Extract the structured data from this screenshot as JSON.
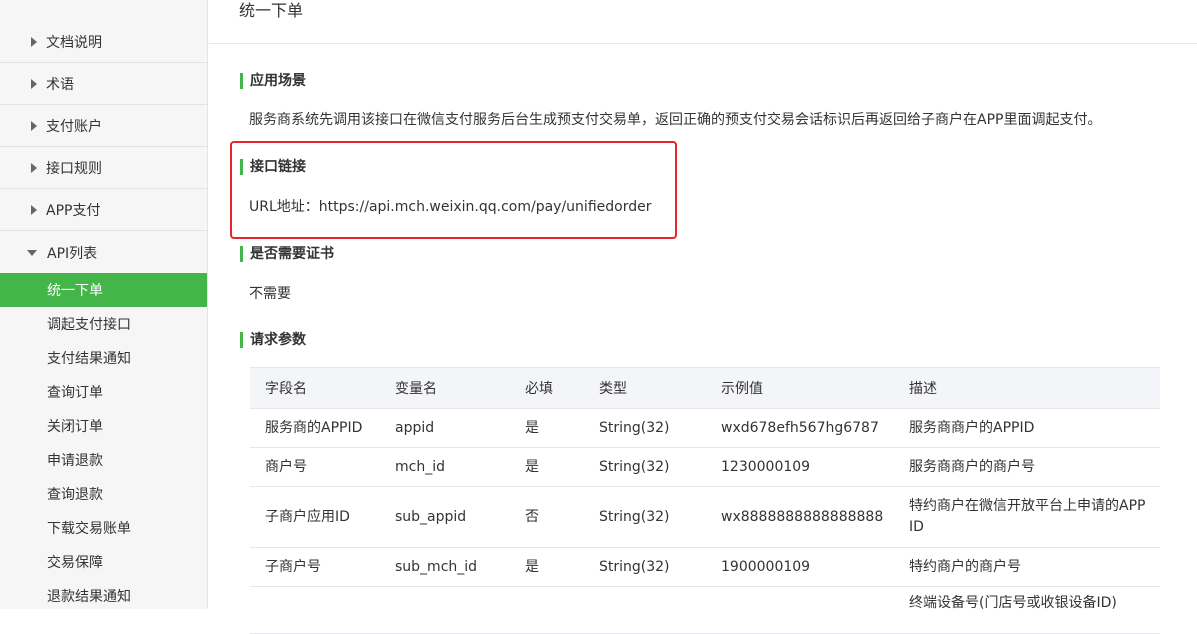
{
  "sidebar": {
    "groups": [
      {
        "label": "文档说明"
      },
      {
        "label": "术语"
      },
      {
        "label": "支付账户"
      },
      {
        "label": "接口规则"
      },
      {
        "label": "APP支付"
      },
      {
        "label": "API列表"
      }
    ],
    "api_items": [
      {
        "label": "统一下单",
        "active": true
      },
      {
        "label": "调起支付接口"
      },
      {
        "label": "支付结果通知"
      },
      {
        "label": "查询订单"
      },
      {
        "label": "关闭订单"
      },
      {
        "label": "申请退款"
      },
      {
        "label": "查询退款"
      },
      {
        "label": "下载交易账单"
      },
      {
        "label": "交易保障"
      },
      {
        "label": "退款结果通知"
      }
    ]
  },
  "main": {
    "title": "统一下单",
    "scenario": {
      "heading": "应用场景",
      "text": "服务商系统先调用该接口在微信支付服务后台生成预支付交易单，返回正确的预支付交易会话标识后再返回给子商户在APP里面调起支付。"
    },
    "link": {
      "heading": "接口链接",
      "text": "URL地址：https://api.mch.weixin.qq.com/pay/unifiedorder"
    },
    "cert": {
      "heading": "是否需要证书",
      "text": "不需要"
    },
    "params": {
      "heading": "请求参数",
      "columns": [
        "字段名",
        "变量名",
        "必填",
        "类型",
        "示例值",
        "描述"
      ],
      "rows": [
        [
          "服务商的APPID",
          "appid",
          "是",
          "String(32)",
          "wxd678efh567hg6787",
          "服务商商户的APPID"
        ],
        [
          "商户号",
          "mch_id",
          "是",
          "String(32)",
          "1230000109",
          "服务商商户的商户号"
        ],
        [
          "子商户应用ID",
          "sub_appid",
          "否",
          "String(32)",
          "wx8888888888888888",
          "特约商户在微信开放平台上申请的APPID"
        ],
        [
          "子商户号",
          "sub_mch_id",
          "是",
          "String(32)",
          "1900000109",
          "特约商户的商户号"
        ],
        [
          "",
          "",
          "",
          "",
          "",
          "终端设备号(门店号或收银设备ID)"
        ]
      ]
    }
  },
  "colors": {
    "accent": "#44b549",
    "highlight_box": "#e5262b"
  }
}
